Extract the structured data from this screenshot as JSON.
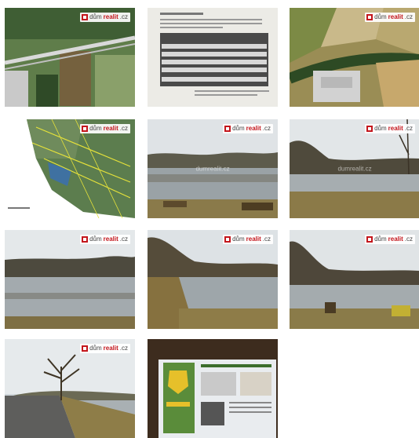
{
  "gallery": {
    "watermark": {
      "part1": "dům",
      "part2": "realit",
      "part3": ".cz",
      "center_text": "dumrealit.cz"
    },
    "colors": {
      "brand_red": "#c4161c"
    },
    "photos": [
      {
        "kind": "aerial-map"
      },
      {
        "kind": "document-table"
      },
      {
        "kind": "aerial-fields"
      },
      {
        "kind": "cadastral-map"
      },
      {
        "kind": "pond"
      },
      {
        "kind": "pond"
      },
      {
        "kind": "pond"
      },
      {
        "kind": "pond"
      },
      {
        "kind": "pond"
      },
      {
        "kind": "road-tree"
      },
      {
        "kind": "info-board"
      }
    ]
  }
}
